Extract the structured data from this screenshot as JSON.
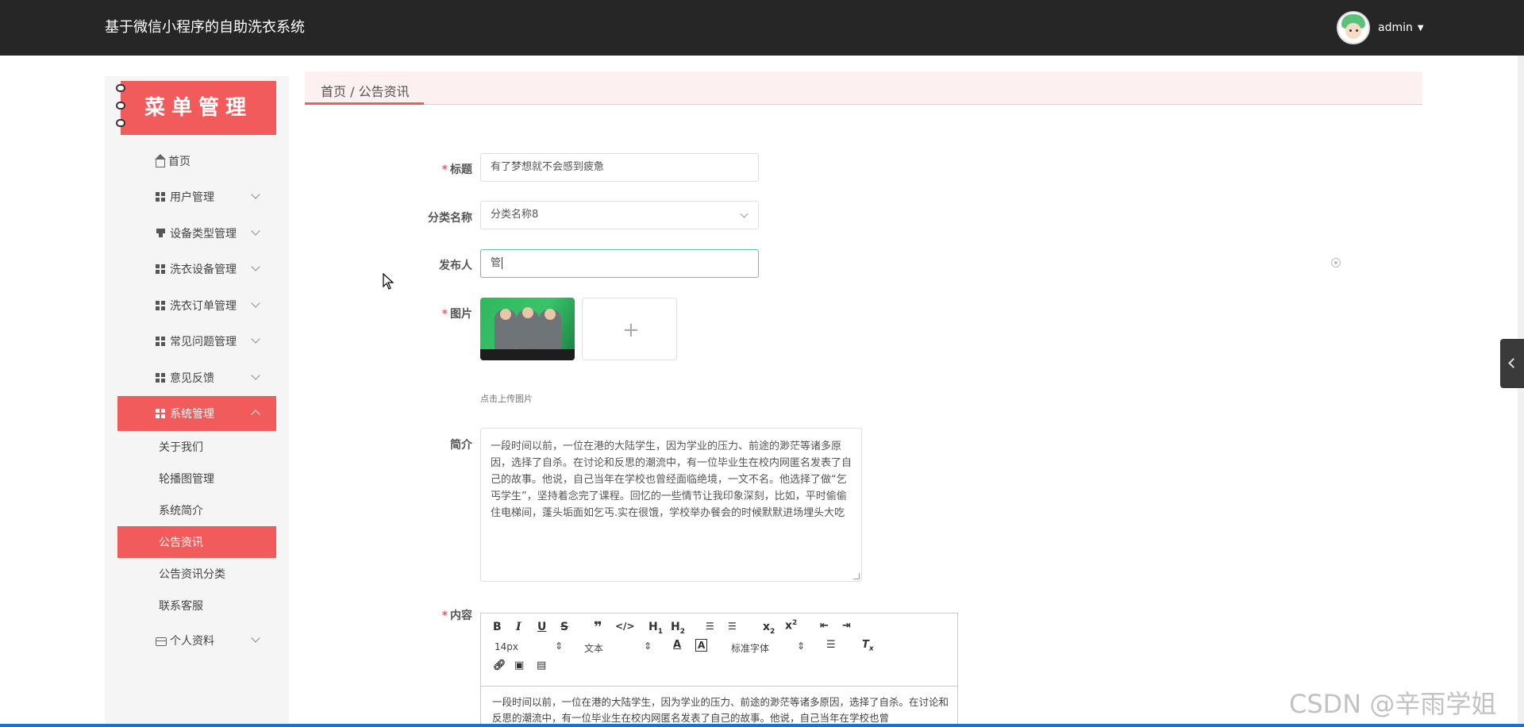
{
  "header": {
    "title": "基于微信小程序的自助洗衣系统",
    "username": "admin"
  },
  "sidebar": {
    "banner": "菜单管理",
    "items": [
      {
        "label": "首页",
        "icon": "home-icon"
      },
      {
        "label": "用户管理",
        "icon": "grid-icon"
      },
      {
        "label": "设备类型管理",
        "icon": "cup-icon"
      },
      {
        "label": "洗衣设备管理",
        "icon": "grid-icon"
      },
      {
        "label": "洗衣订单管理",
        "icon": "grid-icon"
      },
      {
        "label": "常见问题管理",
        "icon": "grid-icon"
      },
      {
        "label": "意见反馈",
        "icon": "grid-icon"
      },
      {
        "label": "系统管理",
        "icon": "grid-icon"
      }
    ],
    "subitems": [
      "关于我们",
      "轮播图管理",
      "系统简介",
      "公告资讯",
      "公告资讯分类",
      "联系客服"
    ],
    "profile": "个人资料"
  },
  "breadcrumb": "首页 / 公告资讯",
  "form": {
    "title_label": "标题",
    "title_value": "有了梦想就不会感到疲惫",
    "category_label": "分类名称",
    "category_value": "分类名称8",
    "publisher_label": "发布人",
    "publisher_value": "管",
    "image_label": "图片",
    "upload_hint": "点击上传图片",
    "intro_label": "简介",
    "intro_value": "一段时间以前，一位在港的大陆学生，因为学业的压力、前途的渺茫等诸多原因，选择了自杀。在讨论和反思的潮流中，有一位毕业生在校内网匿名发表了自己的故事。他说，自己当年在学校也曾经面临绝境，一文不名。他选择了做“乞丐学生”，坚持着念完了课程。回忆的一些情节让我印象深刻，比如，平时偷偷住电梯间，蓬头垢面如乞丐.实在很饿，学校举办餐会的时候默默进场埋头大吃",
    "content_label": "内容",
    "content_value": "一段时间以前，一位在港的大陆学生，因为学业的压力、前途的渺茫等诸多原因，选择了自杀。在讨论和反思的潮流中，有一位毕业生在校内网匿名发表了自己的故事。他说，自己当年在学校也曾"
  },
  "editor": {
    "font_size": "14px",
    "heading": "文本",
    "font_family": "标准字体"
  },
  "watermark": "CSDN @辛雨学姐",
  "colors": {
    "accent": "#f25b5b",
    "topbar": "#262626",
    "focus": "#5ec69a"
  }
}
